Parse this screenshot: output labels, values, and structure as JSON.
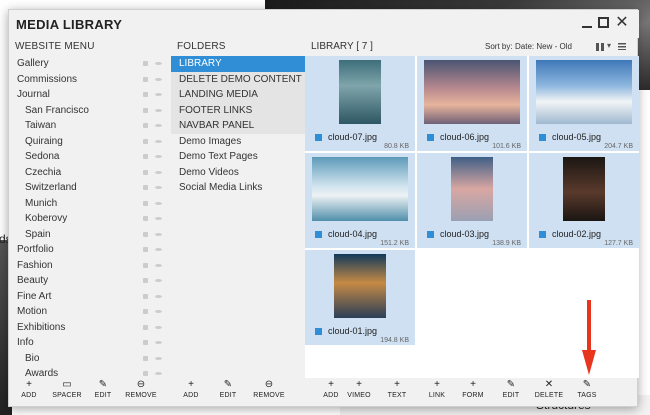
{
  "background": {
    "ghost_text": "ds",
    "structures_text": "Structures"
  },
  "window": {
    "title": "MEDIA LIBRARY"
  },
  "menu": {
    "header": "WEBSITE MENU",
    "items": [
      {
        "label": "Gallery",
        "sub": false
      },
      {
        "label": "Commissions",
        "sub": false
      },
      {
        "label": "Journal",
        "sub": false
      },
      {
        "label": "San Francisco",
        "sub": true
      },
      {
        "label": "Taiwan",
        "sub": true
      },
      {
        "label": "Quiraing",
        "sub": true
      },
      {
        "label": "Sedona",
        "sub": true
      },
      {
        "label": "Czechia",
        "sub": true
      },
      {
        "label": "Switzerland",
        "sub": true
      },
      {
        "label": "Munich",
        "sub": true
      },
      {
        "label": "Koberovy",
        "sub": true
      },
      {
        "label": "Spain",
        "sub": true
      },
      {
        "label": "Portfolio",
        "sub": false
      },
      {
        "label": "Fashion",
        "sub": false
      },
      {
        "label": "Beauty",
        "sub": false
      },
      {
        "label": "Fine Art",
        "sub": false
      },
      {
        "label": "Motion",
        "sub": false
      },
      {
        "label": "Exhibitions",
        "sub": false
      },
      {
        "label": "Info",
        "sub": false
      },
      {
        "label": "Bio",
        "sub": true
      },
      {
        "label": "Awards",
        "sub": true
      }
    ]
  },
  "folders": {
    "header": "FOLDERS",
    "items": [
      {
        "label": "LIBRARY",
        "state": "selected"
      },
      {
        "label": "DELETE DEMO CONTENT",
        "state": "shaded"
      },
      {
        "label": "LANDING MEDIA",
        "state": "shaded"
      },
      {
        "label": "FOOTER LINKS",
        "state": "shaded"
      },
      {
        "label": "NAVBAR PANEL",
        "state": "shaded"
      },
      {
        "label": "Demo Images",
        "state": "normal"
      },
      {
        "label": "Demo Text Pages",
        "state": "normal"
      },
      {
        "label": "Demo Videos",
        "state": "normal"
      },
      {
        "label": "Social Media Links",
        "state": "normal"
      }
    ]
  },
  "library": {
    "title": "LIBRARY  [ 7 ]",
    "sort_label": "Sort by:",
    "sort_value": "Date: New - Old",
    "files": [
      {
        "name": "cloud-07.jpg",
        "size": "80.8 KB"
      },
      {
        "name": "cloud-06.jpg",
        "size": "101.6 KB"
      },
      {
        "name": "cloud-05.jpg",
        "size": "204.7 KB"
      },
      {
        "name": "cloud-04.jpg",
        "size": "151.2 KB"
      },
      {
        "name": "cloud-03.jpg",
        "size": "138.9 KB"
      },
      {
        "name": "cloud-02.jpg",
        "size": "127.7 KB"
      },
      {
        "name": "cloud-01.jpg",
        "size": "194.8 KB"
      }
    ]
  },
  "toolbars": {
    "menu": [
      {
        "label": "ADD",
        "icon": "+"
      },
      {
        "label": "SPACER",
        "icon": "▭"
      },
      {
        "label": "EDIT",
        "icon": "✎"
      },
      {
        "label": "REMOVE",
        "icon": "⊖"
      }
    ],
    "folders": [
      {
        "label": "ADD",
        "icon": "+"
      },
      {
        "label": "EDIT",
        "icon": "✎"
      },
      {
        "label": "REMOVE",
        "icon": "⊖"
      }
    ],
    "library": [
      {
        "label": "ADD",
        "icon": "+"
      },
      {
        "label": "VIMEO",
        "icon": "+"
      },
      {
        "label": "TEXT",
        "icon": "+"
      },
      {
        "label": "LINK",
        "icon": "+"
      },
      {
        "label": "FORM",
        "icon": "+"
      },
      {
        "label": "EDIT",
        "icon": "✎"
      },
      {
        "label": "DELETE",
        "icon": "✕"
      },
      {
        "label": "TAGS",
        "icon": "✎"
      }
    ]
  },
  "accent_color": "#2f8ed6",
  "annotation_color": "#e8351e"
}
